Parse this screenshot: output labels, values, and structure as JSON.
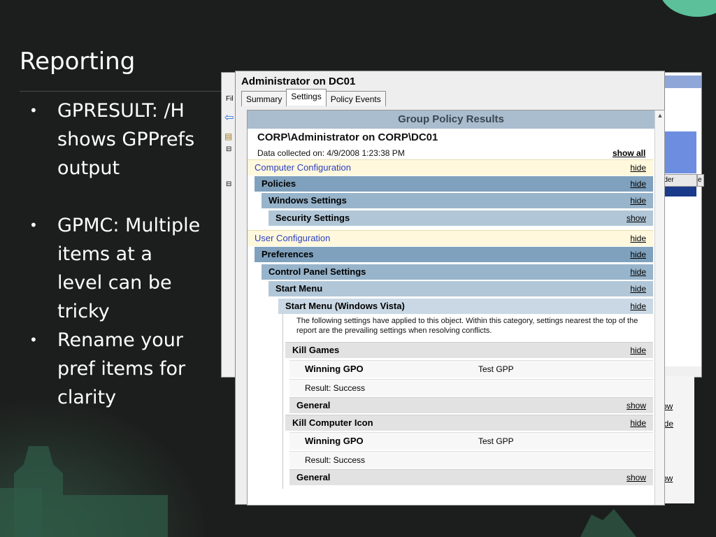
{
  "slide": {
    "title": "Reporting",
    "bullets": [
      "GPRESULT:  /H shows GPPrefs output",
      "GPMC: Multiple items at a level can be tricky",
      "Rename your pref items for clarity"
    ]
  },
  "background_window": {
    "menu_fragment": "Fil",
    "column_header": "rder",
    "column_header2": "e",
    "links": [
      "ow",
      "ide",
      "ow"
    ]
  },
  "window": {
    "title": "Administrator on DC01",
    "tabs": [
      {
        "label": "Summary",
        "active": false
      },
      {
        "label": "Settings",
        "active": true
      },
      {
        "label": "Policy Events",
        "active": false
      }
    ]
  },
  "report": {
    "header": "Group Policy Results",
    "subject": "CORP\\Administrator on CORP\\DC01",
    "collected": "Data collected on: 4/9/2008 1:23:38 PM",
    "show_all": "show all",
    "rows": [
      {
        "label": "Computer Configuration",
        "link": "hide"
      },
      {
        "label": "Policies",
        "link": "hide"
      },
      {
        "label": "Windows Settings",
        "link": "hide"
      },
      {
        "label": "Security Settings",
        "link": "show"
      },
      {
        "label": "User Configuration",
        "link": "hide"
      },
      {
        "label": "Preferences",
        "link": "hide"
      },
      {
        "label": "Control Panel Settings",
        "link": "hide"
      },
      {
        "label": "Start Menu",
        "link": "hide"
      },
      {
        "label": "Start Menu (Windows Vista)",
        "link": "hide"
      }
    ],
    "info_text": "The following settings have applied to this object. Within this category, settings nearest the top of the report are the prevailing settings when resolving conflicts.",
    "items": [
      {
        "name": "Kill Games",
        "link": "hide",
        "winning_gpo_label": "Winning GPO",
        "winning_gpo_value": "Test GPP",
        "result": "Result: Success",
        "general": "General",
        "general_link": "show"
      },
      {
        "name": "Kill Computer Icon",
        "link": "hide",
        "winning_gpo_label": "Winning GPO",
        "winning_gpo_value": "Test GPP",
        "result": "Result: Success",
        "general": "General",
        "general_link": "show"
      }
    ]
  }
}
